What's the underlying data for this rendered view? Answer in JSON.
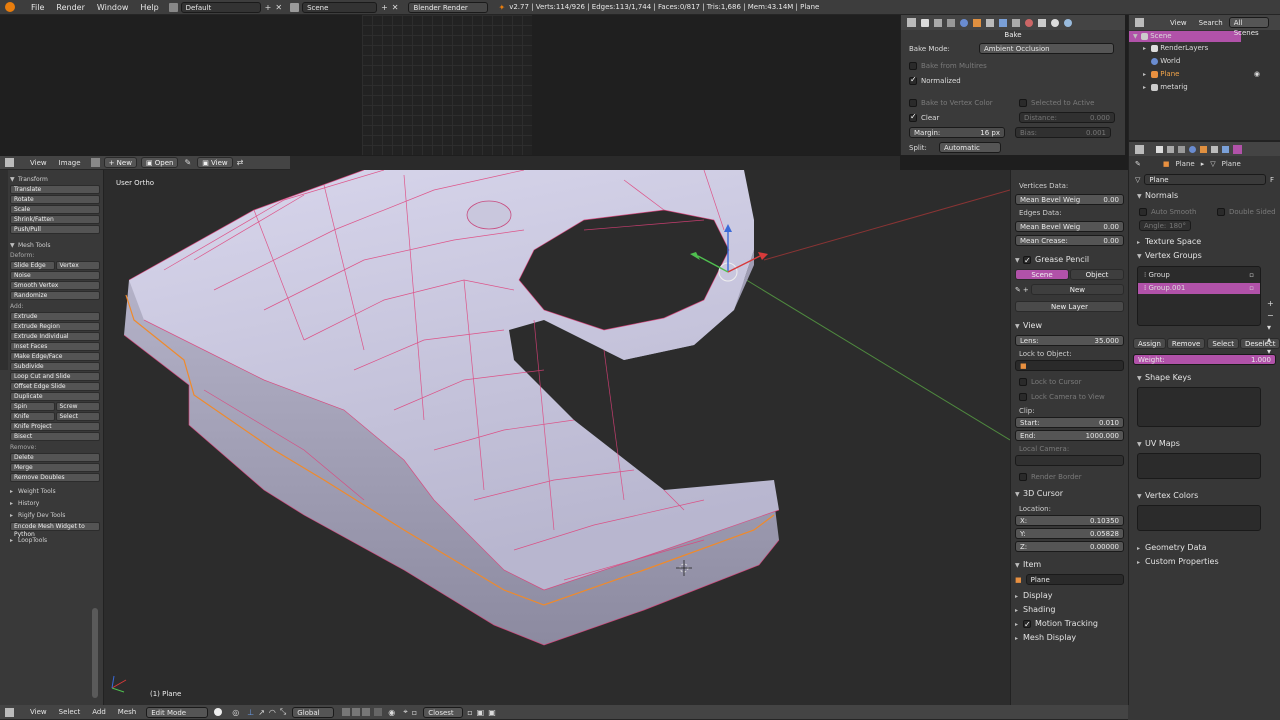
{
  "topbar": {
    "menus": [
      "File",
      "Render",
      "Window",
      "Help"
    ],
    "screen_layout": "Default",
    "scene": "Scene",
    "engine": "Blender Render",
    "stats": "v2.77 | Verts:114/926 | Edges:113/1,744 | Faces:0/817 | Tris:1,686 | Mem:43.14M | Plane"
  },
  "bake": {
    "title": "Bake",
    "mode_label": "Bake Mode:",
    "mode_value": "Ambient Occlusion",
    "from_multires": "Bake from Multires",
    "normalized": "Normalized",
    "to_vertex_color": "Bake to Vertex Color",
    "selected_to_active": "Selected to Active",
    "clear": "Clear",
    "distance_label": "Distance:",
    "distance_value": "0.000",
    "margin_label": "Margin:",
    "margin_value": "16 px",
    "bias_label": "Bias:",
    "bias_value": "0.001",
    "split_label": "Split:",
    "split_value": "Automatic"
  },
  "outliner": {
    "menus": [
      "View",
      "Search",
      "All Scenes"
    ],
    "items": [
      {
        "label": "Scene",
        "indent": 0
      },
      {
        "label": "RenderLayers",
        "indent": 1
      },
      {
        "label": "World",
        "indent": 1
      },
      {
        "label": "Plane",
        "indent": 1
      },
      {
        "label": "metarig",
        "indent": 1
      }
    ]
  },
  "image_editor_header": {
    "menus": [
      "View",
      "Image"
    ],
    "new": "New",
    "open": "Open",
    "view": "View"
  },
  "viewport": {
    "label": "User Ortho",
    "object_label": "(1) Plane"
  },
  "toolshelf": {
    "transform_title": "Transform",
    "transform": [
      "Translate",
      "Rotate",
      "Scale",
      "Shrink/Fatten",
      "Push/Pull"
    ],
    "mesh_tools_title": "Mesh Tools",
    "deform_label": "Deform:",
    "slide_edge": "Slide Edge",
    "vertex": "Vertex",
    "deform": [
      "Noise",
      "Smooth Vertex",
      "Randomize"
    ],
    "add_label": "Add:",
    "add": [
      "Extrude",
      "Extrude Region",
      "Extrude Individual",
      "Inset Faces",
      "Make Edge/Face",
      "Subdivide",
      "Loop Cut and Slide",
      "Offset Edge Slide",
      "Duplicate"
    ],
    "spin": "Spin",
    "screw": "Screw",
    "knife": "Knife",
    "select": "Select",
    "add2": [
      "Knife Project",
      "Bisect"
    ],
    "remove_label": "Remove:",
    "remove": [
      "Delete",
      "Merge",
      "Remove Doubles"
    ],
    "collapsed": [
      "Weight Tools",
      "History",
      "Rigify Dev Tools"
    ],
    "encode": "Encode Mesh Widget to Python",
    "looptools": "LoopTools"
  },
  "nsidebar": {
    "vertices_data": "Vertices Data:",
    "mean_bevel_weight": "Mean Bevel Weig",
    "mean_bevel_weight_v": "0.00",
    "edges_data": "Edges Data:",
    "mean_bevel_weight2_v": "0.00",
    "mean_crease": "Mean Crease:",
    "mean_crease_v": "0.00",
    "grease_pencil": "Grease Pencil",
    "scene_tab": "Scene",
    "object_tab": "Object",
    "new": "New",
    "new_layer": "New Layer",
    "view_title": "View",
    "lens_label": "Lens:",
    "lens_value": "35.000",
    "lock_to_object": "Lock to Object:",
    "lock_to_cursor": "Lock to Cursor",
    "lock_camera": "Lock Camera to View",
    "clip": "Clip:",
    "start_label": "Start:",
    "start_value": "0.010",
    "end_label": "End:",
    "end_value": "1000.000",
    "local_camera": "Local Camera:",
    "render_border": "Render Border",
    "cursor_title": "3D Cursor",
    "location": "Location:",
    "x_label": "X:",
    "x_value": "0.10350",
    "y_label": "Y:",
    "y_value": "0.05828",
    "z_label": "Z:",
    "z_value": "0.00000",
    "item_title": "Item",
    "item_value": "Plane",
    "display": "Display",
    "shading": "Shading",
    "motion_tracking": "Motion Tracking",
    "mesh_display": "Mesh Display"
  },
  "properties": {
    "breadcrumb_obj": "Plane",
    "breadcrumb_data": "Plane",
    "name_value": "Plane",
    "normals": "Normals",
    "auto_smooth": "Auto Smooth",
    "double_sided": "Double Sided",
    "angle_label": "Angle:",
    "angle_value": "180°",
    "texture_space": "Texture Space",
    "vertex_groups": "Vertex Groups",
    "groups": [
      "Group",
      "Group.001"
    ],
    "assign": "Assign",
    "remove": "Remove",
    "select": "Select",
    "deselect": "Deselect",
    "weight_label": "Weight:",
    "weight_value": "1.000",
    "shape_keys": "Shape Keys",
    "uv_maps": "UV Maps",
    "vertex_colors": "Vertex Colors",
    "geometry_data": "Geometry Data",
    "custom_properties": "Custom Properties"
  },
  "bottom_header": {
    "menus": [
      "View",
      "Select",
      "Add",
      "Mesh"
    ],
    "mode": "Edit Mode",
    "orientation": "Global",
    "pivot": "Closest"
  },
  "colors": {
    "accent": "#b152a9",
    "mesh_wire": "#e0407a",
    "selected_edge": "#f08a2a",
    "mesh_fill": "#c8c6df"
  }
}
